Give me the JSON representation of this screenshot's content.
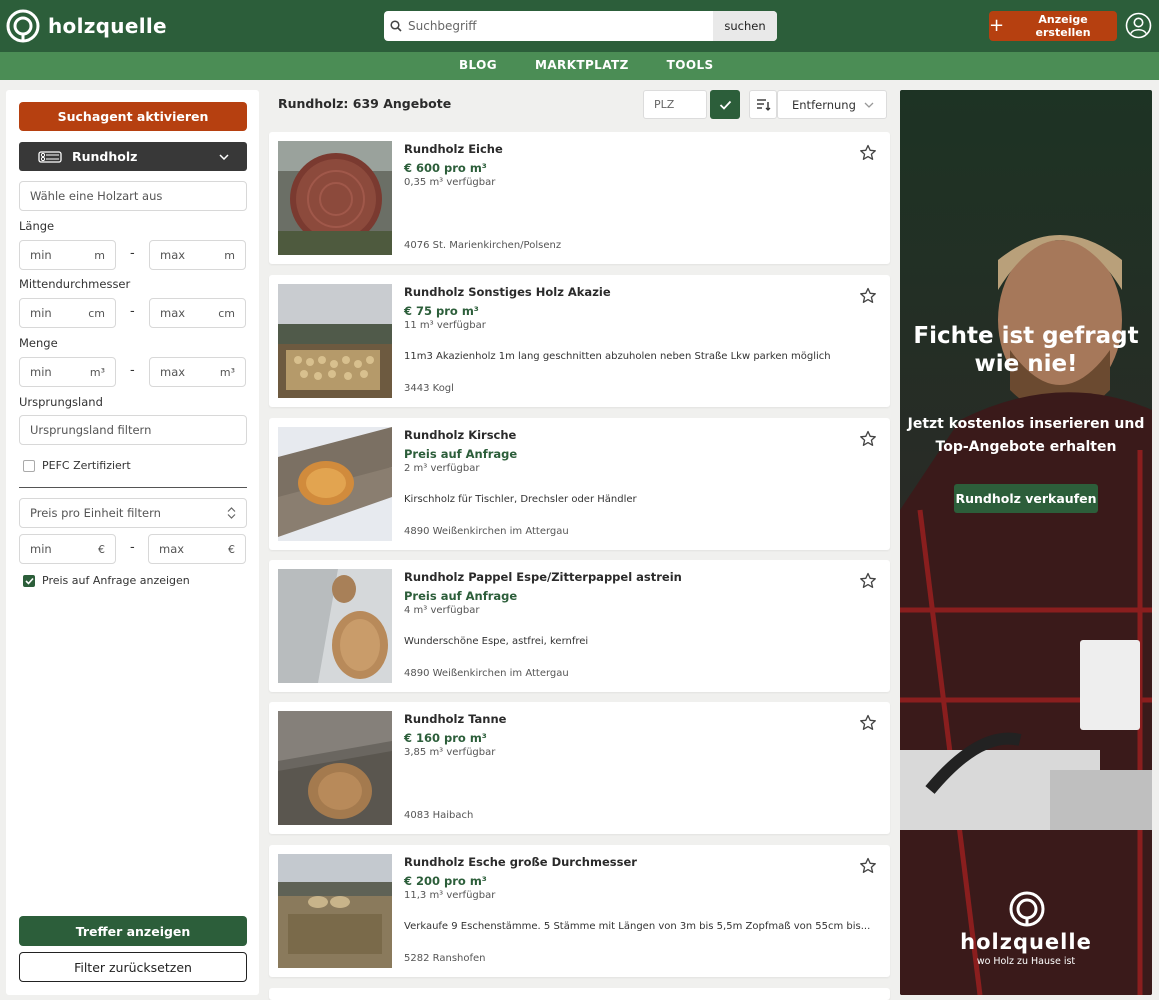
{
  "brand": {
    "name": "holzquelle"
  },
  "search": {
    "placeholder": "Suchbegriff",
    "button": "suchen"
  },
  "header": {
    "create_label": "Anzeige erstellen"
  },
  "nav": {
    "items": [
      "BLOG",
      "MARKTPLATZ",
      "TOOLS"
    ]
  },
  "sidebar": {
    "agent_button": "Suchagent aktivieren",
    "category": "Rundholz",
    "wood_type_placeholder": "Wähle eine Holzart aus",
    "length": {
      "label": "Länge",
      "min": "min",
      "max": "max",
      "unit": "m"
    },
    "diameter": {
      "label": "Mittendurchmesser",
      "min": "min",
      "max": "max",
      "unit": "cm"
    },
    "quantity": {
      "label": "Menge",
      "min": "min",
      "max": "max",
      "unit": "m³"
    },
    "origin": {
      "label": "Ursprungsland",
      "placeholder": "Ursprungsland filtern"
    },
    "pefc_label": "PEFC Zertifiziert",
    "pefc_checked": false,
    "price_unit_select": "Preis pro Einheit filtern",
    "price": {
      "min": "min",
      "max": "max",
      "unit": "€"
    },
    "on_request_label": "Preis auf Anfrage anzeigen",
    "on_request_checked": true,
    "show_button": "Treffer anzeigen",
    "reset_button": "Filter zurücksetzen"
  },
  "results": {
    "title": "Rundholz: 639 Angebote",
    "plz_placeholder": "PLZ",
    "sort": "Entfernung",
    "listings": [
      {
        "title": "Rundholz Eiche",
        "price": "€ 600 pro m³",
        "availability": "0,35 m³ verfügbar",
        "description": "",
        "location": "4076 St. Marienkirchen/Polsenz"
      },
      {
        "title": "Rundholz Sonstiges Holz Akazie",
        "price": "€ 75 pro m³",
        "availability": "11 m³ verfügbar",
        "description": "11m3 Akazienholz 1m lang geschnitten abzuholen neben Straße Lkw parken möglich",
        "location": "3443 Kogl"
      },
      {
        "title": "Rundholz Kirsche",
        "price": "Preis auf Anfrage",
        "availability": "2 m³ verfügbar",
        "description": "Kirschholz für Tischler, Drechsler oder Händler",
        "location": "4890 Weißenkirchen im Attergau"
      },
      {
        "title": "Rundholz Pappel Espe/Zitterpappel astrein",
        "price": "Preis auf Anfrage",
        "availability": "4 m³ verfügbar",
        "description": "Wunderschöne Espe, astfrei, kernfrei",
        "location": "4890 Weißenkirchen im Attergau"
      },
      {
        "title": "Rundholz Tanne",
        "price": "€ 160 pro m³",
        "availability": "3,85 m³ verfügbar",
        "description": "",
        "location": "4083 Haibach"
      },
      {
        "title": "Rundholz Esche große Durchmesser",
        "price": "€ 200 pro m³",
        "availability": "11,3 m³ verfügbar",
        "description": "Verkaufe 9 Eschenstämme. 5 Stämme mit Längen von 3m bis 5,5m Zopfmaß von 55cm bis...",
        "location": "5282 Ranshofen"
      }
    ]
  },
  "ad": {
    "headline_1": "Fichte ist gefragt",
    "headline_2": "wie nie!",
    "subline_1": "Jetzt kostenlos inserieren und",
    "subline_2": "Top-Angebote erhalten",
    "button": "Rundholz verkaufen",
    "brand": "holzquelle",
    "tagline": "wo Holz zu Hause ist"
  },
  "colors": {
    "primary_green": "#2c5e3a",
    "nav_green": "#4b8d55",
    "accent_orange": "#b64010"
  }
}
